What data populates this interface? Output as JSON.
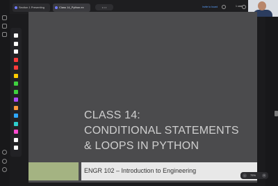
{
  "tabs": [
    {
      "label": "Section 1 Presenting"
    },
    {
      "label": "Class 14_Python.ex"
    }
  ],
  "zoom_pill": "• • •",
  "topbar": {
    "share_label": "Invite to board",
    "user_label": "1 user"
  },
  "slide": {
    "title_lines": [
      "CLASS 14:",
      "CONDITIONAL STATEMENTS",
      "& LOOPS IN PYTHON"
    ],
    "footer": "ENGR 102 – Introduction to Engineering"
  },
  "zoom_control": {
    "minus": "–",
    "value": "75%",
    "plus": "+"
  },
  "colors": {
    "slide_bg": "#4b4b4d",
    "green_accent": "#a4b382",
    "footer_bg": "#e8e8e8",
    "palette_tools": [
      "#ffffff",
      "#ffffff",
      "#ffffff",
      "#ff3b3b",
      "#ff3b3b",
      "#ffcc00",
      "#3fd13f",
      "#3fd13f",
      "#b14bff",
      "#ff9a3c",
      "#2ea8ff",
      "#2ecfcf",
      "#ff4bd1",
      "#ffffff",
      "#ffffff"
    ]
  }
}
